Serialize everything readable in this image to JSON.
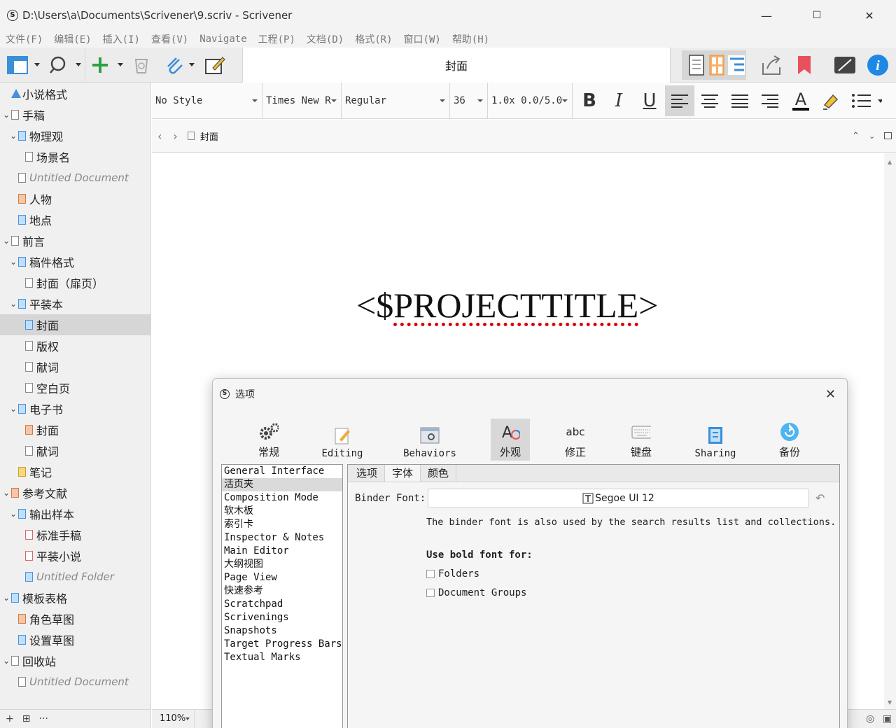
{
  "window": {
    "title": "D:\\Users\\a\\Documents\\Scrivener\\9.scriv - Scrivener",
    "minimize": "—",
    "maximize": "☐",
    "close": "✕"
  },
  "menu": [
    "文件(F)",
    "编辑(E)",
    "插入(I)",
    "查看(V)",
    "Navigate",
    "工程(P)",
    "文档(D)",
    "格式(R)",
    "窗口(W)",
    "帮助(H)"
  ],
  "toolbar": {
    "document_title": "封面"
  },
  "binder": {
    "items": [
      {
        "label": "小说格式",
        "italic": false
      },
      {
        "label": "手稿",
        "italic": false
      },
      {
        "label": "物理观",
        "italic": false
      },
      {
        "label": "场景名",
        "italic": false
      },
      {
        "label": "Untitled Document",
        "italic": true
      },
      {
        "label": "人物",
        "italic": false
      },
      {
        "label": "地点",
        "italic": false
      },
      {
        "label": "前言",
        "italic": false
      },
      {
        "label": "稿件格式",
        "italic": false
      },
      {
        "label": "封面（扉页）",
        "italic": false
      },
      {
        "label": "平装本",
        "italic": false
      },
      {
        "label": "封面",
        "italic": false
      },
      {
        "label": "版权",
        "italic": false
      },
      {
        "label": "献词",
        "italic": false
      },
      {
        "label": "空白页",
        "italic": false
      },
      {
        "label": "电子书",
        "italic": false
      },
      {
        "label": "封面",
        "italic": false
      },
      {
        "label": "献词",
        "italic": false
      },
      {
        "label": "笔记",
        "italic": false
      },
      {
        "label": "参考文献",
        "italic": false
      },
      {
        "label": "输出样本",
        "italic": false
      },
      {
        "label": "标准手稿",
        "italic": false
      },
      {
        "label": "平装小说",
        "italic": false
      },
      {
        "label": "Untitled Folder",
        "italic": true
      },
      {
        "label": "模板表格",
        "italic": false
      },
      {
        "label": "角色草图",
        "italic": false
      },
      {
        "label": "设置草图",
        "italic": false
      },
      {
        "label": "回收站",
        "italic": false
      },
      {
        "label": "Untitled Document",
        "italic": true
      }
    ],
    "footer": {
      "add": "+",
      "add_folder": "⊞",
      "more": "···"
    }
  },
  "formatbar": {
    "style": "No Style",
    "font": "Times New R",
    "weight": "Regular",
    "size": "36",
    "spacing": "1.0x 0.0/5.0",
    "bold": "B",
    "italic": "I",
    "underline": "U"
  },
  "header": {
    "doc_name": "封面"
  },
  "editor": {
    "text_open": "<$",
    "text_word": "PROJECTTITLE",
    "text_close": ">",
    "zoom": "110%"
  },
  "dialog": {
    "title": "选项",
    "tabs": [
      {
        "label": "常规",
        "en": false
      },
      {
        "label": "Editing",
        "en": true
      },
      {
        "label": "Behaviors",
        "en": true
      },
      {
        "label": "外观",
        "en": false
      },
      {
        "label": "修正",
        "en": false
      },
      {
        "label": "键盘",
        "en": false
      },
      {
        "label": "Sharing",
        "en": true
      },
      {
        "label": "备份",
        "en": false
      }
    ],
    "categories": [
      "General Interface",
      "活页夹",
      "Composition Mode",
      "软木板",
      "索引卡",
      "Inspector & Notes",
      "Main Editor",
      "大纲视图",
      "Page View",
      "快速参考",
      "Scratchpad",
      "Scrivenings",
      "Snapshots",
      "Target Progress Bars",
      "Textual Marks"
    ],
    "subtabs": [
      "选项",
      "字体",
      "颜色"
    ],
    "binder_font_label": "Binder Font:",
    "binder_font_value": "Segoe UI 12",
    "font_desc": "The binder font is also used by the search results list and collections.",
    "bold_heading": "Use bold font for:",
    "checkbox_folders": "Folders",
    "checkbox_groups": "Document Groups",
    "abc": "abc"
  }
}
